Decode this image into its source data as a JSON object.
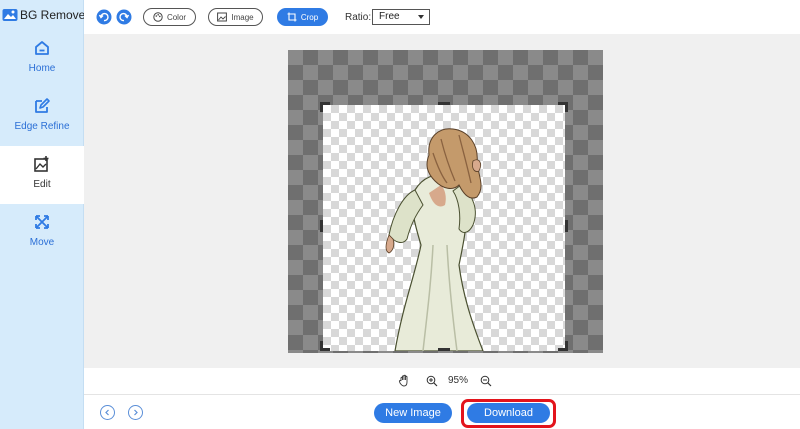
{
  "app": {
    "title": "BG Remover"
  },
  "sidebar": {
    "items": [
      {
        "label": "Home",
        "icon": "home-icon"
      },
      {
        "label": "Edge Refine",
        "icon": "edit-pen-icon"
      },
      {
        "label": "Edit",
        "icon": "image-edit-icon",
        "active": true
      },
      {
        "label": "Move",
        "icon": "move-arrows-icon"
      }
    ]
  },
  "toolbar": {
    "undo_icon": "undo-icon",
    "redo_icon": "redo-icon",
    "color_label": "Color",
    "image_label": "Image",
    "crop_label": "Crop",
    "ratio_label": "Ratio:",
    "ratio_value": "Free"
  },
  "zoom": {
    "value": "95%"
  },
  "actions": {
    "new_image_label": "New Image",
    "download_label": "Download"
  },
  "colors": {
    "accent": "#2f7be4",
    "sidebar_bg": "#d6ebfb",
    "highlight": "#e3141c"
  }
}
